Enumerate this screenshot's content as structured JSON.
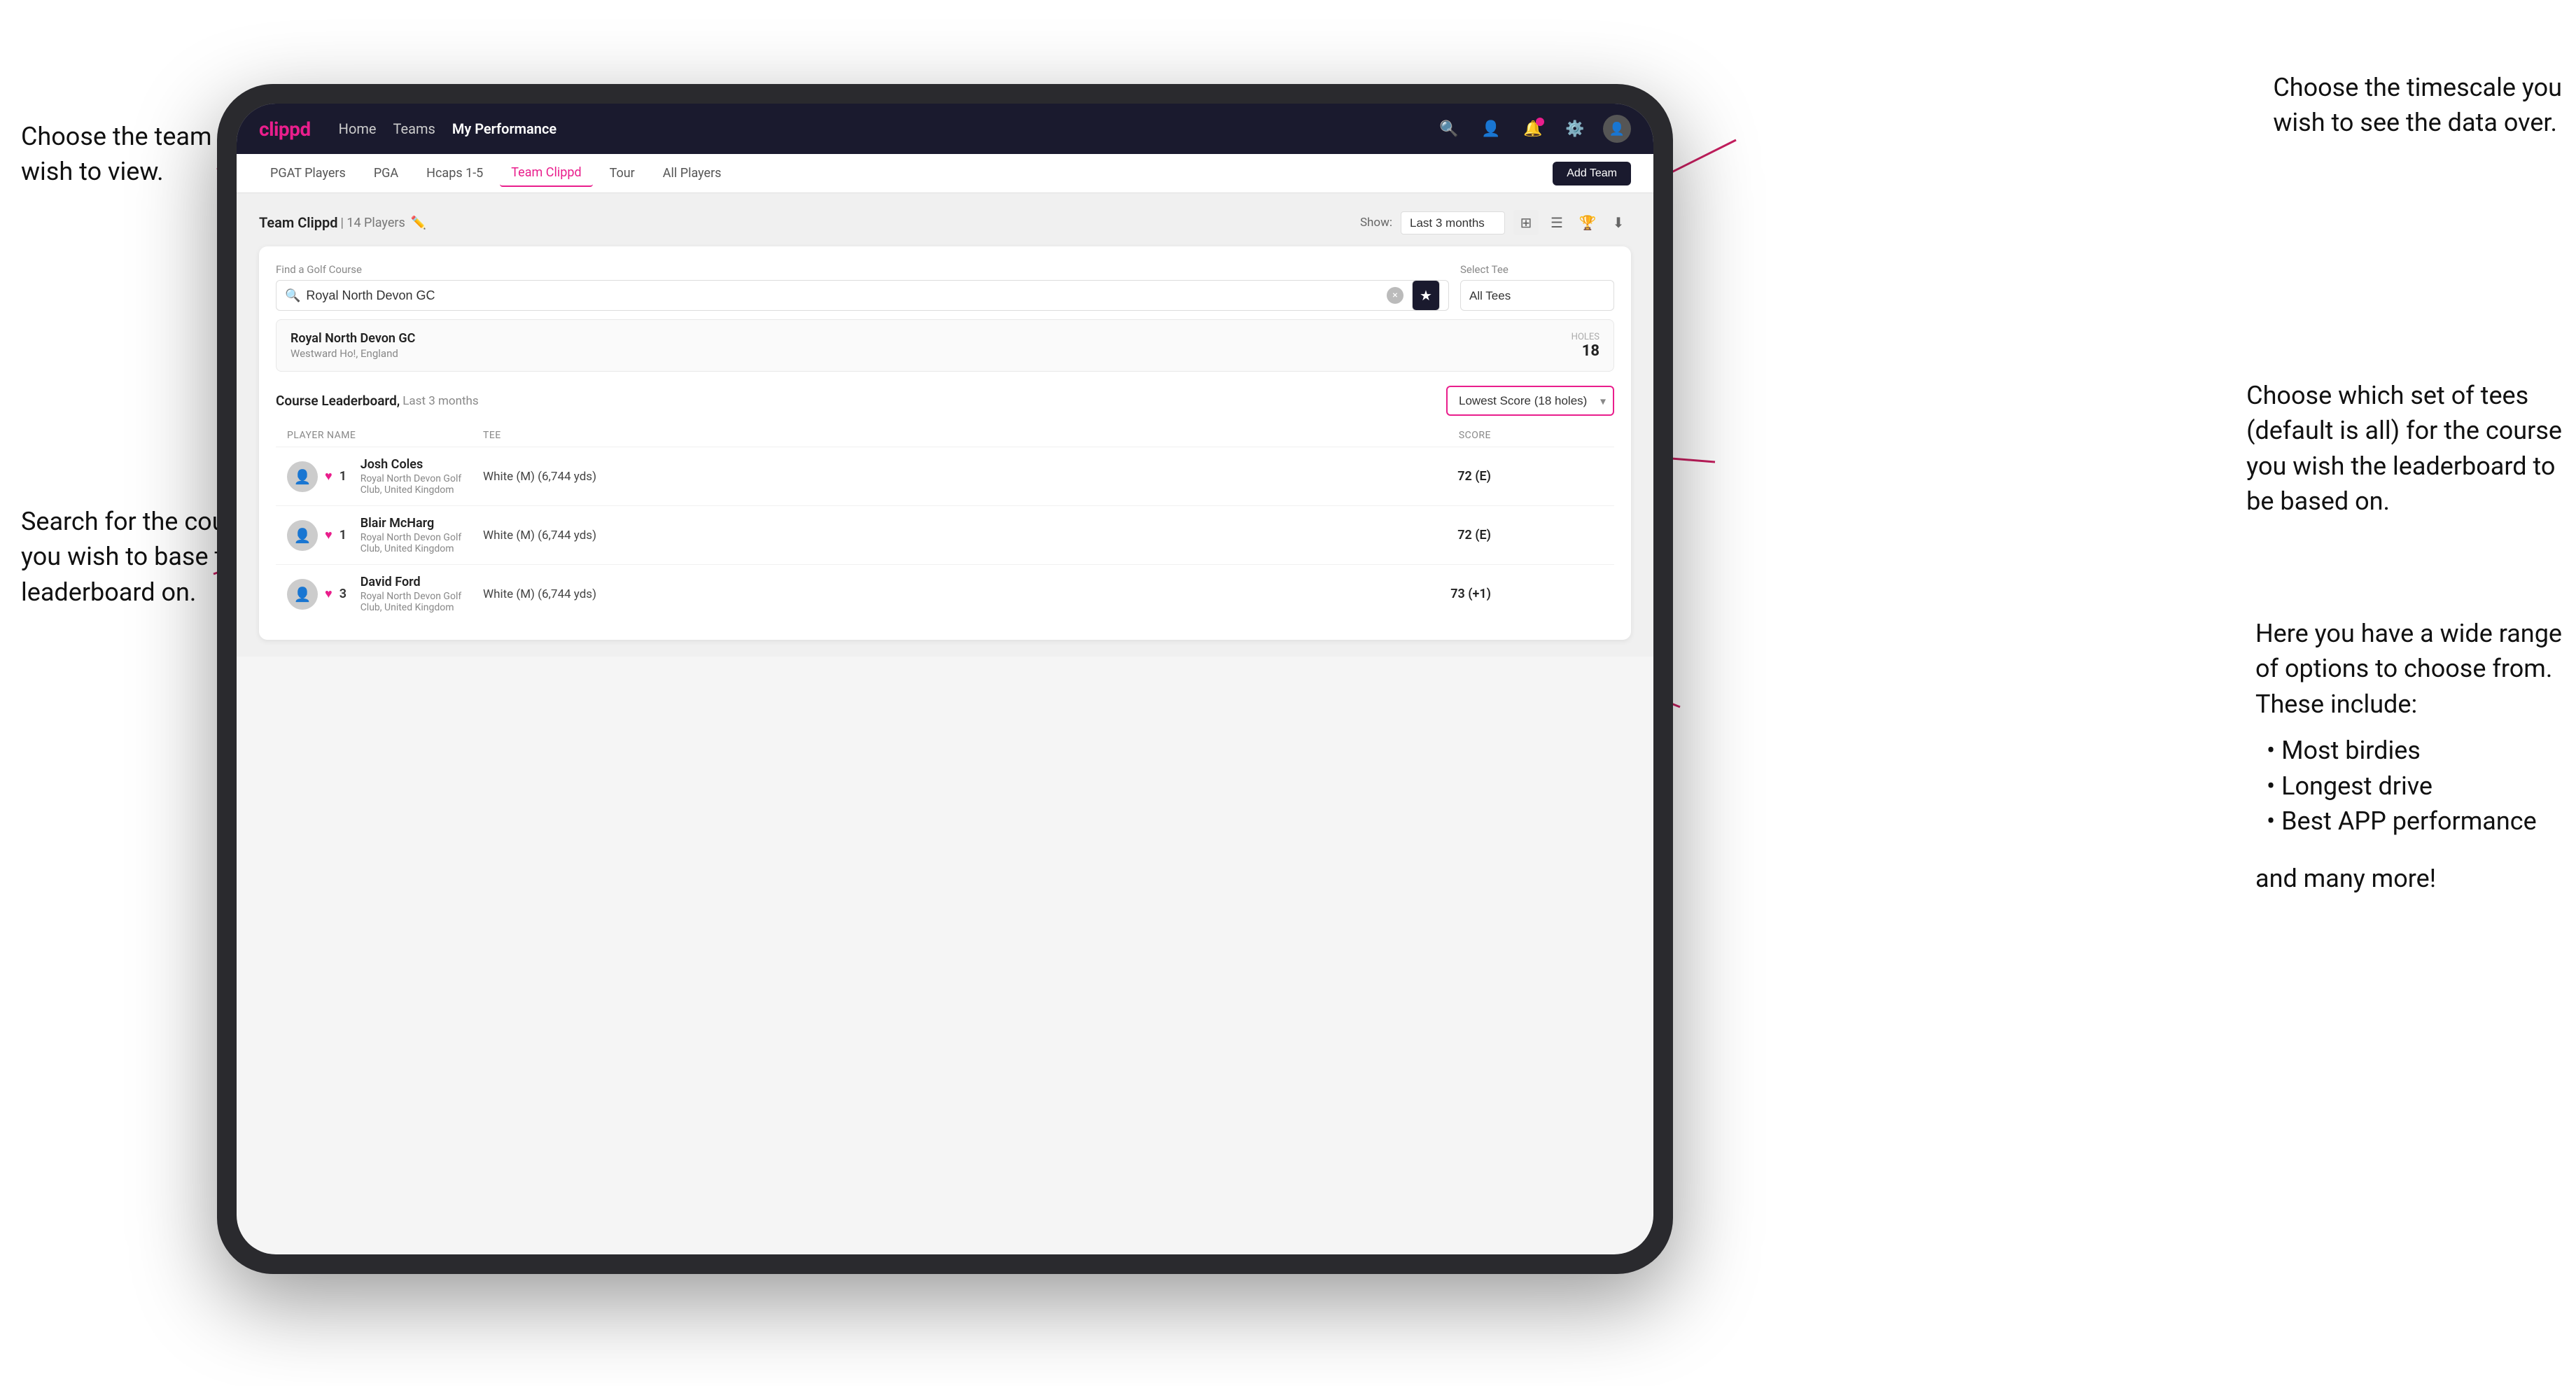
{
  "annotations": {
    "top_left_1": "Choose the team you",
    "top_left_2": "wish to view.",
    "mid_left_1": "Search for the course",
    "mid_left_2": "you wish to base the",
    "mid_left_3": "leaderboard on.",
    "top_right_1": "Choose the timescale you",
    "top_right_2": "wish to see the data over.",
    "mid_right_1": "Choose which set of tees",
    "mid_right_2": "(default is all) for the course",
    "mid_right_3": "you wish the leaderboard to",
    "mid_right_4": "be based on.",
    "lower_right_1": "Here you have a wide range",
    "lower_right_2": "of options to choose from.",
    "lower_right_3": "These include:",
    "bullet_1": "Most birdies",
    "bullet_2": "Longest drive",
    "bullet_3": "Best APP performance",
    "and_more": "and many more!"
  },
  "navbar": {
    "logo": "clippd",
    "links": [
      "Home",
      "Teams",
      "My Performance"
    ],
    "active_link": "My Performance"
  },
  "subnav": {
    "tabs": [
      "PGAT Players",
      "PGA",
      "Hcaps 1-5",
      "Team Clippd",
      "Tour",
      "All Players"
    ],
    "active_tab": "Team Clippd",
    "add_team_label": "Add Team"
  },
  "team_header": {
    "name": "Team Clippd",
    "player_count": "14 Players",
    "show_label": "Show:",
    "show_value": "Last 3 months"
  },
  "search": {
    "find_label": "Find a Golf Course",
    "placeholder": "Royal North Devon GC",
    "tee_label": "Select Tee",
    "tee_value": "All Tees"
  },
  "course_result": {
    "name": "Royal North Devon GC",
    "location": "Westward Ho!, England",
    "holes_label": "Holes",
    "holes_value": "18"
  },
  "leaderboard": {
    "title": "Course Leaderboard,",
    "subtitle": "Last 3 months",
    "score_option": "Lowest Score (18 holes)",
    "columns": {
      "player": "PLAYER NAME",
      "tee": "TEE",
      "score": "SCORE"
    },
    "players": [
      {
        "rank": "1",
        "name": "Josh Coles",
        "club": "Royal North Devon Golf Club, United Kingdom",
        "tee": "White (M) (6,744 yds)",
        "score": "72 (E)"
      },
      {
        "rank": "1",
        "name": "Blair McHarg",
        "club": "Royal North Devon Golf Club, United Kingdom",
        "tee": "White (M) (6,744 yds)",
        "score": "72 (E)"
      },
      {
        "rank": "3",
        "name": "David Ford",
        "club": "Royal North Devon Golf Club, United Kingdom",
        "tee": "White (M) (6,744 yds)",
        "score": "73 (+1)"
      }
    ]
  },
  "right_panel": {
    "options_title": "These include:",
    "bullets": [
      "Most birdies",
      "Longest drive",
      "Best APP performance"
    ],
    "footer": "and many more!"
  }
}
